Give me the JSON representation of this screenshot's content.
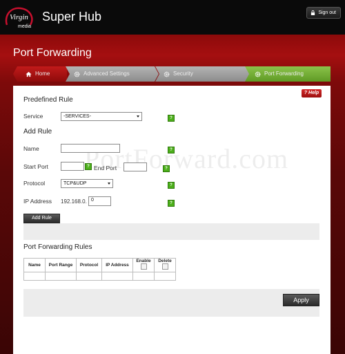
{
  "header": {
    "app_title": "Super Hub",
    "logo_text": "Virgin media",
    "signout_label": "Sign out"
  },
  "page": {
    "title": "Port Forwarding",
    "help_label": "? Help",
    "watermark": "PortForward.com"
  },
  "breadcrumbs": [
    {
      "label": "Home",
      "icon": "home-icon",
      "state": "home"
    },
    {
      "label": "Advanced Settings",
      "icon": "gear-icon",
      "state": "inactive"
    },
    {
      "label": "Security",
      "icon": "gear-icon",
      "state": "inactive"
    },
    {
      "label": "Port Forwarding",
      "icon": "gear-icon",
      "state": "active"
    }
  ],
  "predefined": {
    "heading": "Predefined Rule",
    "service_label": "Service",
    "service_value": "-SERVICES-"
  },
  "add_rule": {
    "heading": "Add Rule",
    "name_label": "Name",
    "name_value": "",
    "start_port_label": "Start Port",
    "start_port_value": "",
    "end_port_label": "End Port",
    "end_port_value": "",
    "protocol_label": "Protocol",
    "protocol_value": "TCP&UDP",
    "ip_label": "IP Address",
    "ip_prefix": "192.168.0.",
    "ip_value": "0",
    "add_button": "Add Rule"
  },
  "rules_table": {
    "heading": "Port Forwarding Rules",
    "columns": [
      "Name",
      "Port Range",
      "Protocol",
      "IP Address",
      "Enable",
      "Delete"
    ]
  },
  "footer": {
    "apply_button": "Apply"
  },
  "colors": {
    "brand_red": "#a50f10",
    "active_crumb": "#6fae2f",
    "help_green": "#4caf1a"
  }
}
